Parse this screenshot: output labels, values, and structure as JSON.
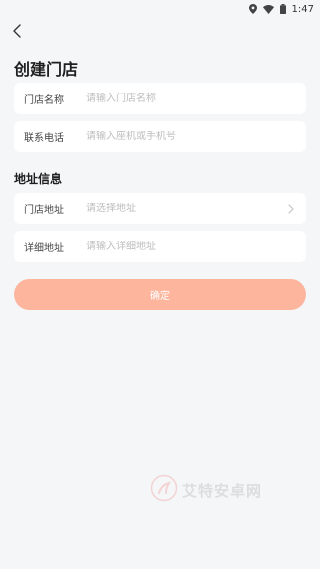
{
  "status_bar": {
    "time": "1:47",
    "icons": [
      "location-icon",
      "wifi-icon",
      "battery-icon"
    ]
  },
  "header": {
    "back_icon": "chevron-left-icon",
    "title": "创建门店"
  },
  "form": {
    "store_name": {
      "label": "门店名称",
      "placeholder": "请输入门店名称"
    },
    "phone": {
      "label": "联系电话",
      "placeholder": "请输入座机或手机号"
    }
  },
  "address": {
    "section_title": "地址信息",
    "store_address": {
      "label": "门店地址",
      "placeholder": "请选择地址"
    },
    "detail_address": {
      "label": "详细地址",
      "placeholder": "请输入详细地址"
    }
  },
  "confirm_label": "确定",
  "watermark": {
    "text": "艾特安卓网"
  },
  "colors": {
    "accent": "#fdb59d",
    "background": "#f5f6f8",
    "card": "#ffffff"
  }
}
